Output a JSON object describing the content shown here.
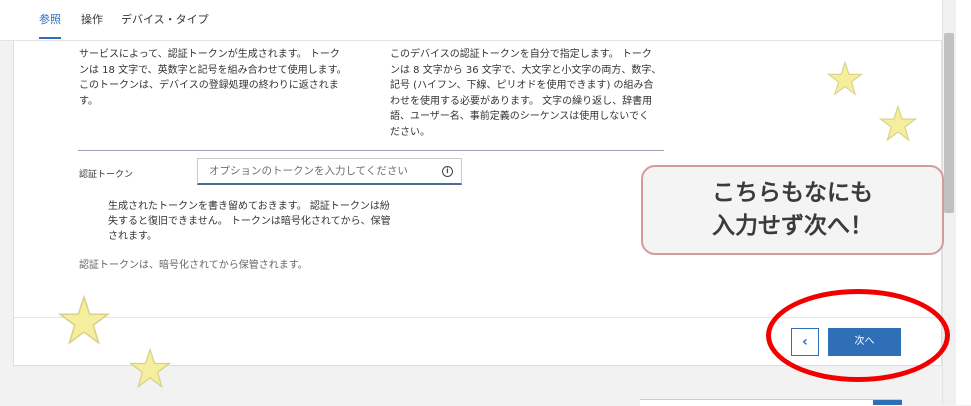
{
  "tabs": [
    {
      "label": "参照",
      "active": true
    },
    {
      "label": "操作",
      "active": false
    },
    {
      "label": "デバイス・タイプ",
      "active": false
    }
  ],
  "left_description": "サービスによって、認証トークンが生成されます。 トーク\nンは 18 文字で、英数字と記号を組み合わせて使用します。\nこのトークンは、デバイスの登録処理の終わりに返されま\nす。",
  "right_description": "このデバイスの認証トークンを自分で指定します。 トーク\nンは 8 文字から 36 文字で、大文字と小文字の両方、数字、\n記号 (ハイフン、下線、ピリオドを使用できます) の組み合\nわせを使用する必要があります。 文字の繰り返し、辞書用\n語、ユーザー名、事前定義のシーケンスは使用しないでく\nださい。",
  "token_field": {
    "label": "認証トークン",
    "value": "",
    "placeholder": "オプションのトークンを入力してください",
    "info_icon": "info-icon"
  },
  "hint_text": "生成されたトークンを書き留めておきます。 認証トークンは紛\n失すると復旧できません。 トークンは暗号化されてから、保管\nされます。",
  "footnote": "認証トークンは、暗号化されてから保管されます。",
  "buttons": {
    "back_icon": "chevron-left-icon",
    "back_glyph": "‹",
    "next_label": "次へ"
  },
  "annotation": {
    "callout_text": "こちらもなにも\n入力せず次へ！",
    "circle_color": "#f20000",
    "star_color": "#f5ee9c"
  },
  "colors": {
    "accent": "#2e6fb7"
  }
}
